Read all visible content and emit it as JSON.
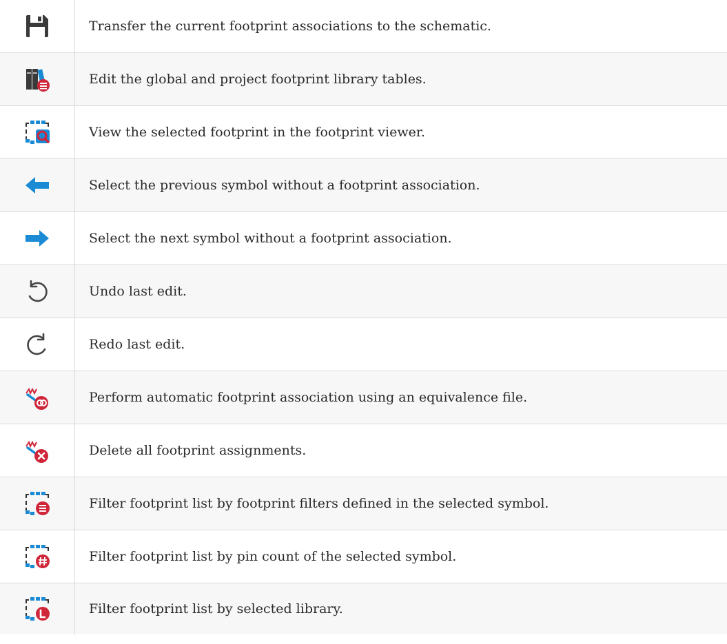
{
  "colors": {
    "blue": "#1a8ad4",
    "red": "#d0263a",
    "dark": "#3a3a3a",
    "grey": "#444444"
  },
  "rows": [
    {
      "icon": "save-icon",
      "description": "Transfer the current footprint associations to the schematic."
    },
    {
      "icon": "library-table-icon",
      "description": "Edit the global and project footprint library tables."
    },
    {
      "icon": "footprint-viewer-icon",
      "description": "View the selected footprint in the footprint viewer."
    },
    {
      "icon": "arrow-left-icon",
      "description": "Select the previous symbol without a footprint association."
    },
    {
      "icon": "arrow-right-icon",
      "description": "Select the next symbol without a footprint association."
    },
    {
      "icon": "undo-icon",
      "description": "Undo last edit."
    },
    {
      "icon": "redo-icon",
      "description": "Redo last edit."
    },
    {
      "icon": "auto-associate-icon",
      "description": "Perform automatic footprint association using an equivalence file."
    },
    {
      "icon": "delete-association-icon",
      "description": "Delete all footprint assignments."
    },
    {
      "icon": "filter-by-symbol-icon",
      "description": "Filter footprint list by footprint filters defined in the selected symbol."
    },
    {
      "icon": "filter-by-pin-count-icon",
      "description": "Filter footprint list by pin count of the selected symbol."
    },
    {
      "icon": "filter-by-library-icon",
      "description": "Filter footprint list by selected library."
    }
  ]
}
